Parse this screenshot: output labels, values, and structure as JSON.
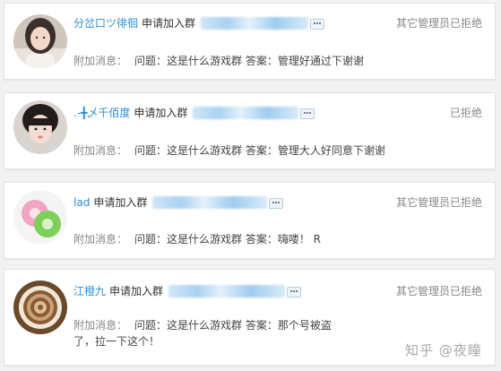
{
  "requests": [
    {
      "nickname": "分岔口ツ徘徊",
      "action": "申请加入群",
      "status": "其它管理员已拒绝",
      "message_label": "附加消息：",
      "message": "问题：这是什么游戏群 答案：管理好通过下谢谢"
    },
    {
      "nickname": ".-╋乄千佰度",
      "action": "申请加入群",
      "status": "已拒绝",
      "message_label": "附加消息：",
      "message": "问题：这是什么游戏群 答案：管理大人好同意下谢谢"
    },
    {
      "nickname": "lad",
      "action": "申请加入群",
      "status": "其它管理员已拒绝",
      "message_label": "附加消息：",
      "message": "问题：这是什么游戏群 答案：嗨喽！ R"
    },
    {
      "nickname": "江橙九",
      "action": "申请加入群",
      "status": "其它管理员已拒绝",
      "message_label": "附加消息：",
      "message": "问题：这是什么游戏群 答案：那个号被盗了，拉一下这个！"
    }
  ],
  "watermark": "知乎 @夜瞳"
}
